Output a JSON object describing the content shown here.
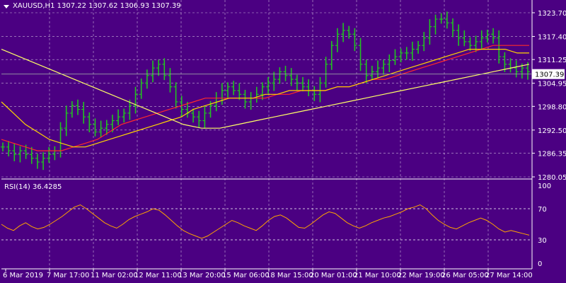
{
  "header": {
    "symbol": "XAUUSD,H1",
    "ohlc": "1307.22 1307.62 1306.93 1307.39"
  },
  "colors": {
    "background": "#4b0082",
    "grid": "#ffffff",
    "candles": "#22c322",
    "ma_red": "#ff2a2a",
    "ma_gold": "#ffd700",
    "ma_yellow": "#ffff66",
    "rsi_line": "#ffa500",
    "price_line": "#9aa0a6",
    "price_tag_bg": "#ffffff",
    "price_tag_text": "#000000"
  },
  "chart_data": [
    {
      "type": "line",
      "title": "XAUUSD,H1",
      "price_ticks": [
        "1323.70",
        "1317.40",
        "1311.25",
        "1304.95",
        "1298.80",
        "1292.50",
        "1286.35",
        "1280.05"
      ],
      "ylim": [
        1280.05,
        1323.7
      ],
      "current_price": "1307.39",
      "x_tick_labels": [
        "6 Mar 2019",
        "7 Mar 17:00",
        "11 Mar 02:00",
        "12 Mar 11:00",
        "13 Mar 20:00",
        "15 Mar 06:00",
        "18 Mar 15:00",
        "20 Mar 01:00",
        "21 Mar 10:00",
        "22 Mar 19:00",
        "26 Mar 05:00",
        "27 Mar 14:00"
      ],
      "price": [
        1288,
        1287,
        1286,
        1287,
        1286,
        1285,
        1284,
        1285,
        1286,
        1287,
        1293,
        1297,
        1299,
        1298,
        1296,
        1294,
        1292,
        1293,
        1294,
        1295,
        1296,
        1297,
        1299,
        1302,
        1305,
        1307,
        1309,
        1310,
        1307,
        1304,
        1300,
        1298,
        1297,
        1296,
        1295,
        1297,
        1299,
        1301,
        1303,
        1304,
        1303,
        1302,
        1300,
        1301,
        1302,
        1304,
        1305,
        1306,
        1308,
        1307,
        1306,
        1305,
        1304,
        1303,
        1302,
        1305,
        1310,
        1315,
        1318,
        1319,
        1318,
        1315,
        1310,
        1307,
        1308,
        1309,
        1310,
        1311,
        1312,
        1313,
        1313,
        1314,
        1315,
        1317,
        1320,
        1322,
        1322,
        1321,
        1319,
        1317,
        1316,
        1315,
        1316,
        1317,
        1318,
        1317,
        1312,
        1310,
        1309,
        1308,
        1309,
        1308
      ],
      "series": [
        {
          "name": "MA red",
          "values": [
            1290,
            1289,
            1288,
            1287,
            1287,
            1287,
            1288,
            1289,
            1290,
            1292,
            1294,
            1295,
            1296,
            1297,
            1298,
            1299,
            1300,
            1301,
            1301,
            1301,
            1301,
            1301,
            1301,
            1302,
            1302,
            1303,
            1303,
            1303,
            1304,
            1304,
            1305,
            1306,
            1306,
            1307,
            1308,
            1309,
            1310,
            1311,
            1312,
            1313,
            1314,
            1315,
            1315,
            1315,
            1315
          ]
        },
        {
          "name": "MA gold",
          "values": [
            1300,
            1297,
            1294,
            1292,
            1290,
            1289,
            1288,
            1288,
            1289,
            1290,
            1291,
            1292,
            1293,
            1294,
            1295,
            1296,
            1298,
            1299,
            1300,
            1301,
            1301,
            1301,
            1302,
            1302,
            1303,
            1303,
            1303,
            1303,
            1304,
            1304,
            1305,
            1306,
            1307,
            1308,
            1309,
            1310,
            1311,
            1312,
            1313,
            1314,
            1314,
            1314,
            1314,
            1313,
            1313
          ]
        },
        {
          "name": "MA yellow",
          "values": [
            1314,
            1312,
            1310,
            1308,
            1306,
            1304,
            1302,
            1300,
            1298,
            1296,
            1294,
            1293,
            1293,
            1294,
            1295,
            1296,
            1297,
            1298,
            1299,
            1300,
            1301,
            1302,
            1303,
            1304,
            1305,
            1306,
            1307,
            1308,
            1309,
            1310
          ]
        }
      ]
    },
    {
      "type": "line",
      "title": "RSI(14) 36.4285",
      "ylim": [
        0,
        100
      ],
      "levels": [
        "100",
        "70",
        "30",
        "0"
      ],
      "values": [
        50,
        45,
        42,
        48,
        52,
        47,
        44,
        46,
        50,
        55,
        60,
        66,
        72,
        75,
        70,
        64,
        58,
        52,
        48,
        45,
        50,
        56,
        60,
        63,
        66,
        70,
        68,
        62,
        55,
        48,
        42,
        38,
        35,
        32,
        35,
        40,
        45,
        50,
        55,
        52,
        48,
        45,
        42,
        48,
        55,
        60,
        62,
        58,
        52,
        46,
        45,
        50,
        56,
        62,
        66,
        64,
        58,
        52,
        48,
        45,
        48,
        52,
        55,
        58,
        60,
        63,
        66,
        70,
        72,
        75,
        70,
        62,
        55,
        50,
        46,
        44,
        48,
        52,
        55,
        58,
        55,
        50,
        44,
        40,
        42,
        40,
        38,
        36
      ]
    }
  ]
}
